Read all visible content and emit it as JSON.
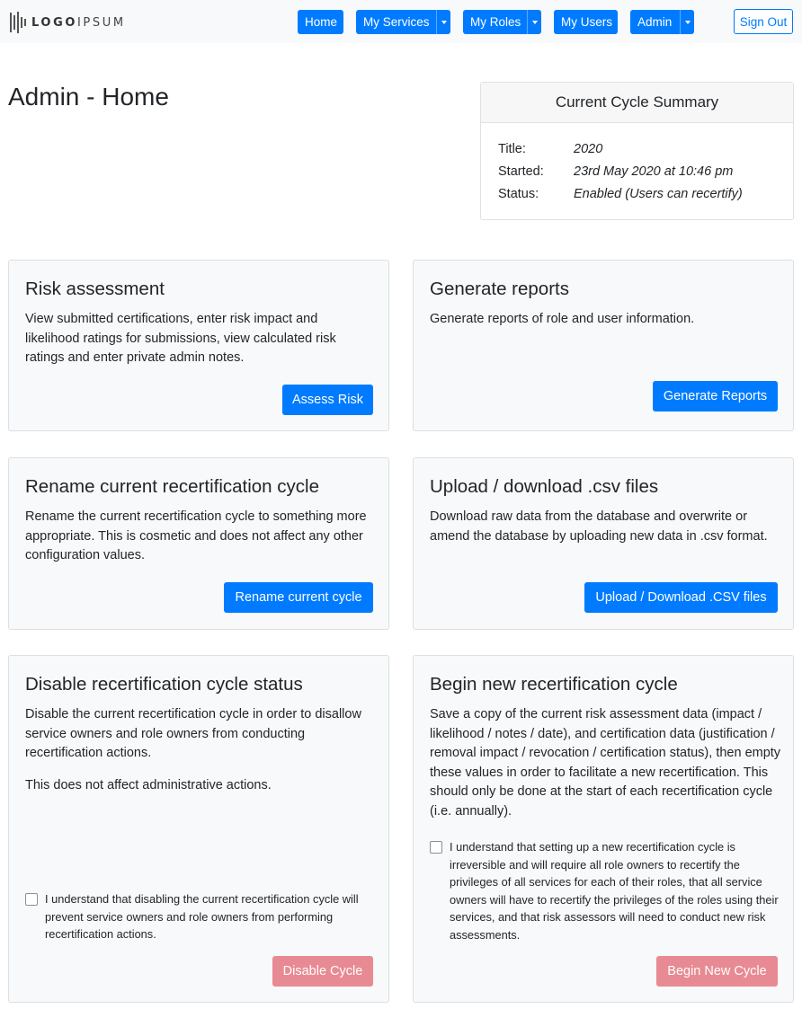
{
  "brand": {
    "logo_text_bold": "LOGO",
    "logo_text_light": "IPSUM"
  },
  "nav": {
    "home": "Home",
    "my_services": "My Services",
    "my_roles": "My Roles",
    "my_users": "My Users",
    "admin": "Admin",
    "sign_out": "Sign Out"
  },
  "page": {
    "title": "Admin - Home"
  },
  "summary": {
    "heading": "Current Cycle Summary",
    "rows": [
      {
        "label": "Title:",
        "value": "2020"
      },
      {
        "label": "Started:",
        "value": "23rd May 2020 at 10:46 pm"
      },
      {
        "label": "Status:",
        "value": "Enabled (Users can recertify)"
      }
    ]
  },
  "cards": {
    "risk": {
      "title": "Risk assessment",
      "desc": "View submitted certifications, enter risk impact and likelihood ratings for submissions, view calculated risk ratings and enter private admin notes.",
      "button": "Assess Risk"
    },
    "reports": {
      "title": "Generate reports",
      "desc": "Generate reports of role and user information.",
      "button": "Generate Reports"
    },
    "rename": {
      "title": "Rename current recertification cycle",
      "desc": "Rename the current recertification cycle to something more appropriate. This is cosmetic and does not affect any other configuration values.",
      "button": "Rename current cycle"
    },
    "csv": {
      "title": "Upload / download .csv files",
      "desc": "Download raw data from the database and overwrite or amend the database by uploading new data in .csv format.",
      "button": "Upload / Download .CSV files"
    },
    "disable": {
      "title": "Disable recertification cycle status",
      "desc": "Disable the current recertification cycle in order to disallow service owners and role owners from conducting recertification actions.",
      "desc2": "This does not affect administrative actions.",
      "checkbox": "I understand that disabling the current recertification cycle will prevent service owners and role owners from performing recertification actions.",
      "button": "Disable Cycle"
    },
    "begin": {
      "title": "Begin new recertification cycle",
      "desc": "Save a copy of the current risk assessment data (impact / likelihood / notes / date), and certification data (justification / removal impact / revocation / certification status), then empty these values in order to facilitate a new recertification. This should only be done at the start of each recertification cycle (i.e. annually).",
      "checkbox": "I understand that setting up a new recertification cycle is irreversible and will require all role owners to recertify the privileges of all services for each of their roles, that all service owners will have to recertify the privileges of the roles using their services, and that risk assessors will need to conduct new risk assessments.",
      "button": "Begin New Cycle"
    }
  },
  "colors": {
    "primary": "#007bff",
    "danger_disabled": "#e88a93",
    "card_bg": "#f8f9fa",
    "navbar_bg": "#f8f9fa"
  }
}
